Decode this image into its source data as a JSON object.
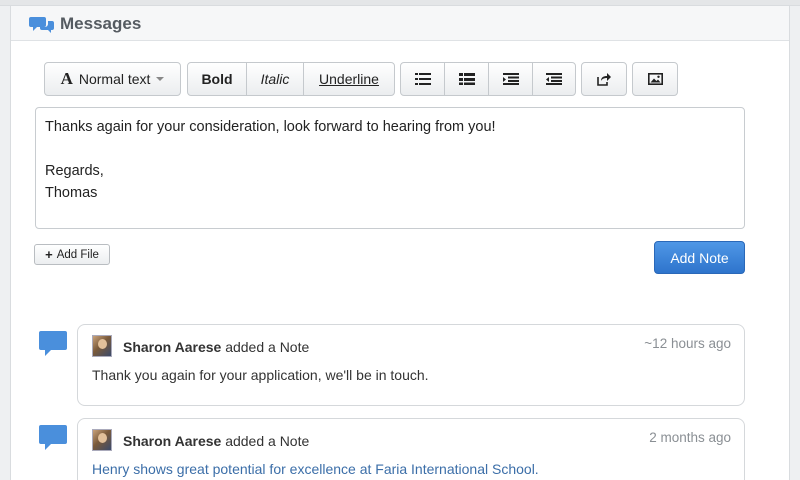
{
  "header": {
    "title": "Messages",
    "icon": "chat-bubbles-icon"
  },
  "toolbar": {
    "format_label": "Normal text",
    "bold_label": "Bold",
    "italic_label": "Italic",
    "underline_label": "Underline",
    "list_icons": [
      "bullet-list-icon",
      "numbered-list-icon",
      "outdent-icon",
      "indent-icon"
    ],
    "link_icon": "share-link-icon",
    "image_icon": "image-icon"
  },
  "editor": {
    "lines": [
      "Thanks again for your consideration, look forward to hearing from you!",
      "",
      "Regards,",
      "Thomas"
    ]
  },
  "actions": {
    "add_file_label": "Add File",
    "add_note_label": "Add Note"
  },
  "notes": [
    {
      "author": "Sharon Aarese",
      "action": "added a Note",
      "time": "~12 hours ago",
      "body": "Thank you again for your application, we'll be in touch."
    },
    {
      "author": "Sharon Aarese",
      "action": "added a Note",
      "time": "2 months ago",
      "body": "Henry shows great potential for excellence at Faria International School."
    }
  ],
  "colors": {
    "accent": "#2e74cc",
    "link_text": "#3b6ea8",
    "bubble": "#4a8fdc"
  }
}
